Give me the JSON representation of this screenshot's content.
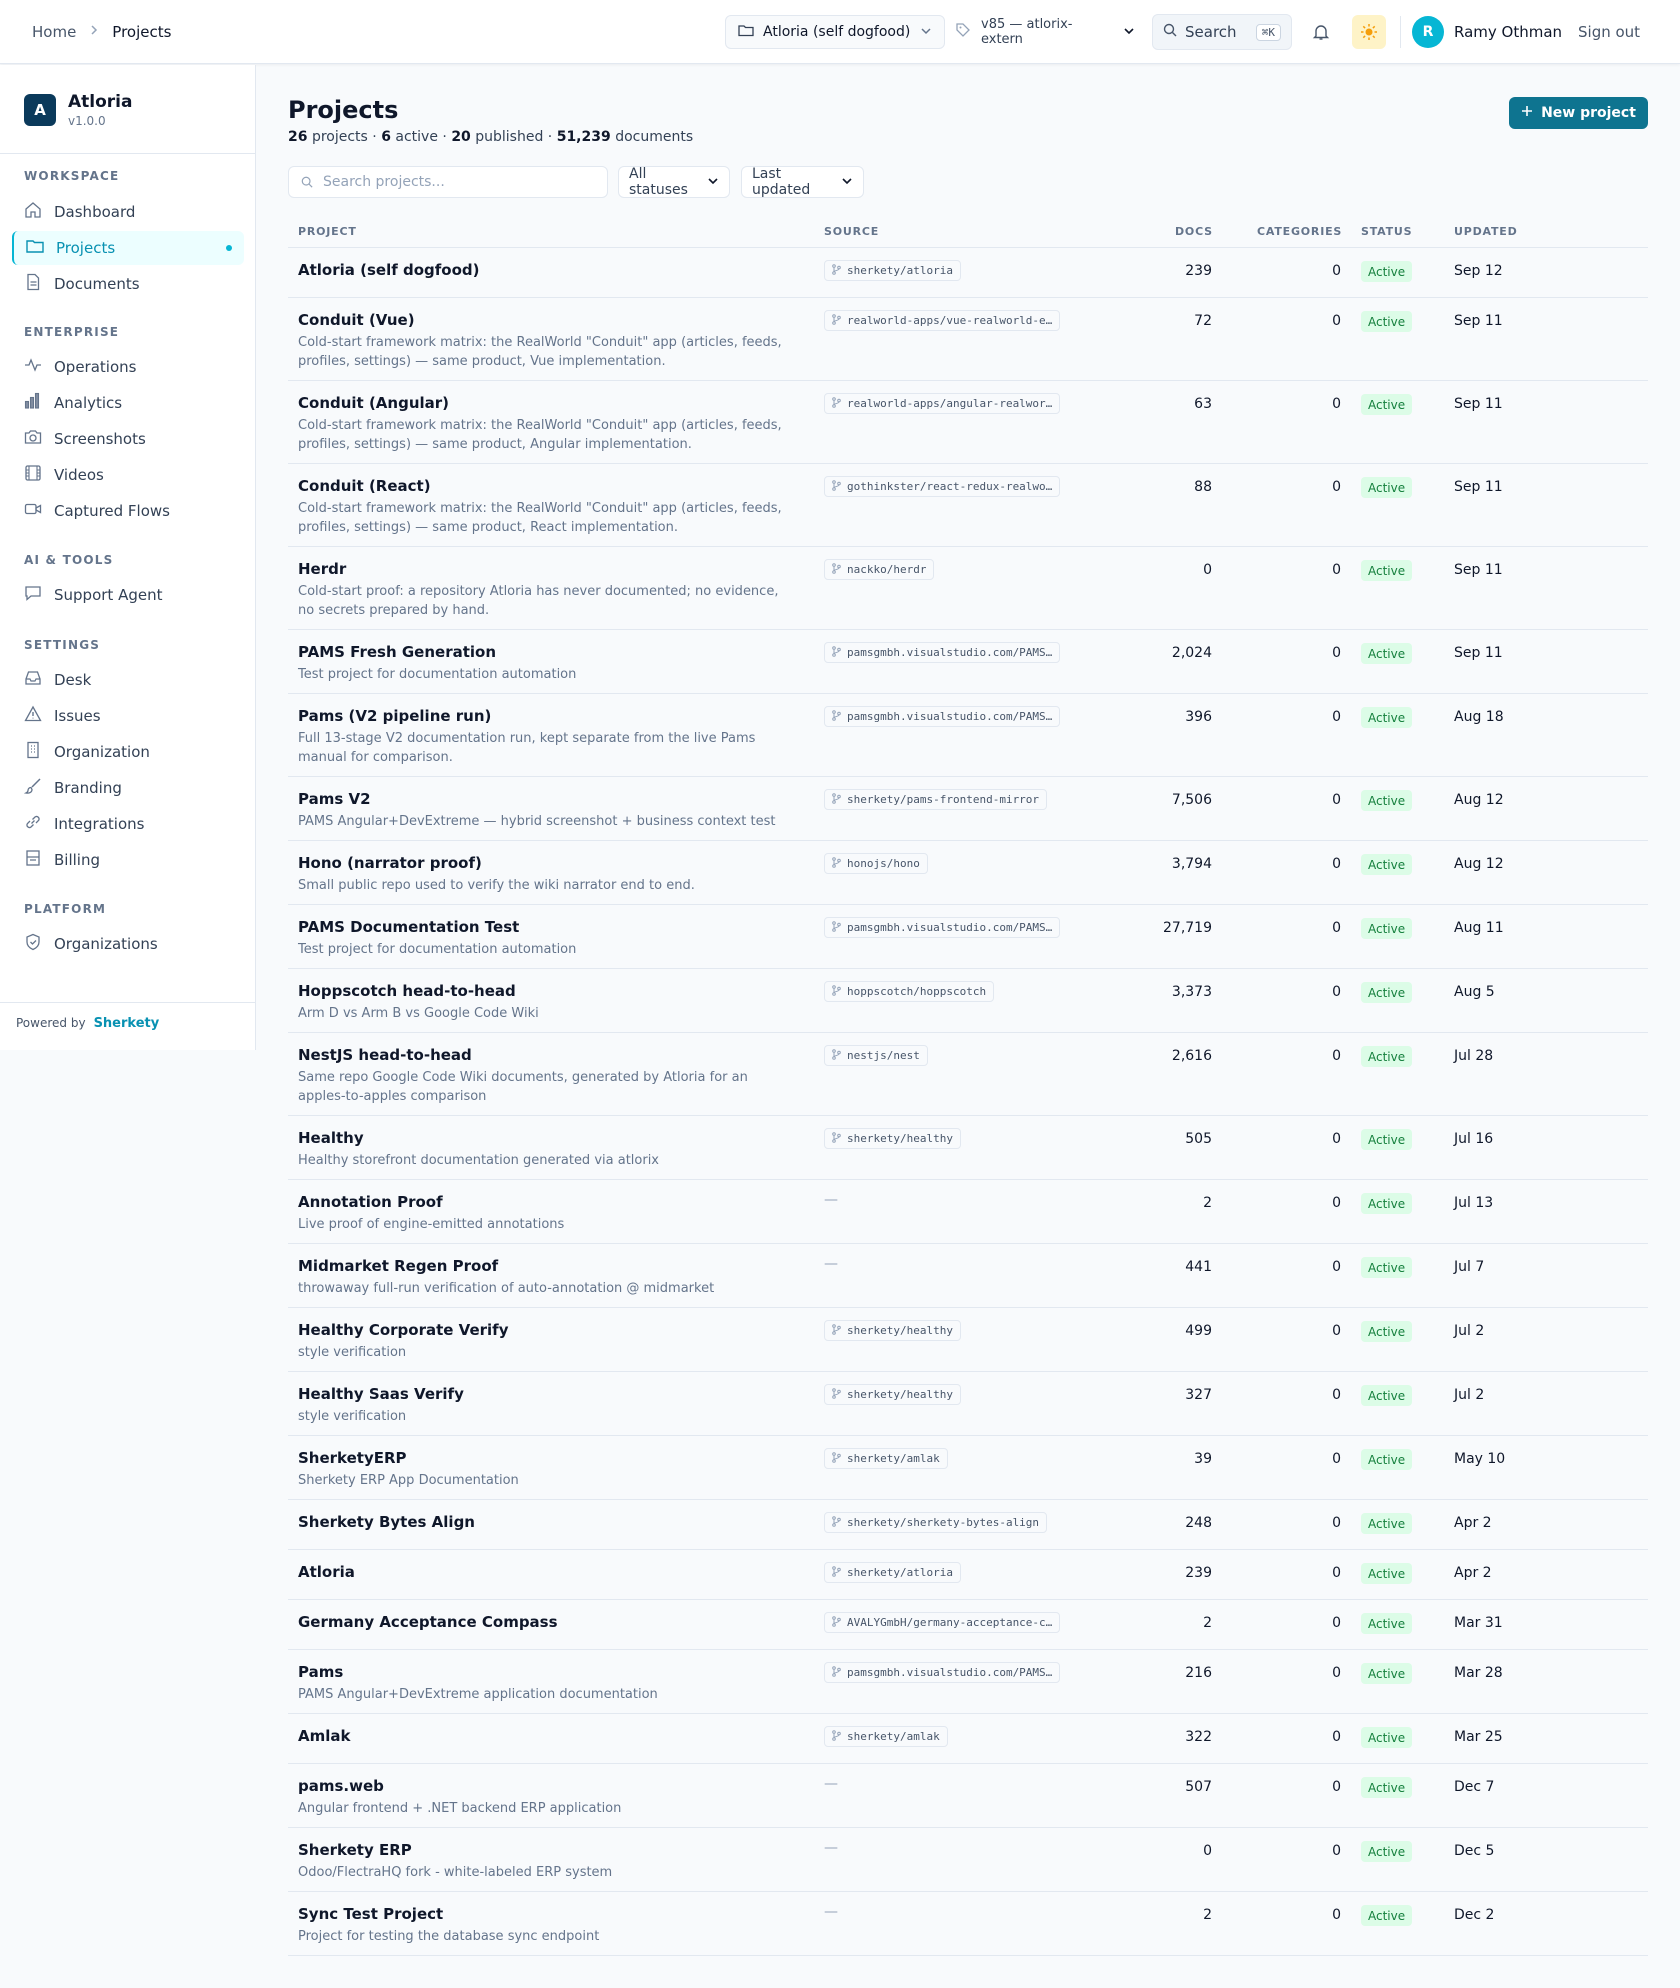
{
  "breadcrumb": {
    "home": "Home",
    "current": "Projects"
  },
  "topbar": {
    "project_switcher": "Atloria (self dogfood)",
    "version": "v85 — atlorix-extern",
    "search_label": "Search",
    "search_shortcut": "⌘K",
    "user_initial": "R",
    "user_name": "Ramy Othman",
    "sign_out": "Sign out"
  },
  "sidebar": {
    "app_name": "Atloria",
    "app_version": "v1.0.0",
    "sections": [
      {
        "title": "WORKSPACE",
        "items": [
          {
            "label": "Dashboard",
            "icon": "home-icon"
          },
          {
            "label": "Projects",
            "icon": "folder-icon",
            "active": true
          },
          {
            "label": "Documents",
            "icon": "document-icon"
          }
        ]
      },
      {
        "title": "ENTERPRISE",
        "items": [
          {
            "label": "Operations",
            "icon": "pulse-icon"
          },
          {
            "label": "Analytics",
            "icon": "bar-chart-icon"
          },
          {
            "label": "Screenshots",
            "icon": "camera-icon"
          },
          {
            "label": "Videos",
            "icon": "film-icon"
          },
          {
            "label": "Captured Flows",
            "icon": "video-camera-icon"
          }
        ]
      },
      {
        "title": "AI & TOOLS",
        "items": [
          {
            "label": "Support Agent",
            "icon": "chat-icon"
          }
        ]
      },
      {
        "title": "SETTINGS",
        "items": [
          {
            "label": "Desk",
            "icon": "inbox-icon"
          },
          {
            "label": "Issues",
            "icon": "warning-icon"
          },
          {
            "label": "Organization",
            "icon": "building-icon"
          },
          {
            "label": "Branding",
            "icon": "brush-icon"
          },
          {
            "label": "Integrations",
            "icon": "link-icon"
          },
          {
            "label": "Billing",
            "icon": "receipt-icon"
          }
        ]
      },
      {
        "title": "PLATFORM",
        "items": [
          {
            "label": "Organizations",
            "icon": "shield-icon"
          }
        ]
      }
    ],
    "powered_by": "Powered by",
    "powered_brand": "Sherkety"
  },
  "main": {
    "title": "Projects",
    "stats": {
      "projects": "26",
      "projects_label": "projects ·",
      "active": "6",
      "active_label": "active ·",
      "published": "20",
      "published_label": "published ·",
      "documents": "51,239",
      "documents_label": "documents"
    },
    "new_project": "New project",
    "search_placeholder": "Search projects...",
    "status_filter": "All statuses",
    "sort": "Last updated"
  },
  "table": {
    "columns": {
      "project": "PROJECT",
      "source": "SOURCE",
      "docs": "DOCS",
      "categories": "CATEGORIES",
      "status": "STATUS",
      "updated": "UPDATED"
    },
    "rows": [
      {
        "name": "Atloria (self dogfood)",
        "desc": "",
        "source": "sherkety/atloria",
        "docs": "239",
        "categories": "0",
        "status": "Active",
        "updated": "Sep 12"
      },
      {
        "name": "Conduit (Vue)",
        "desc": "Cold-start framework matrix: the RealWorld \"Conduit\" app (articles, feeds, profiles, settings) — same product, Vue implementation.",
        "source": "realworld-apps/vue-realworld-e…",
        "docs": "72",
        "categories": "0",
        "status": "Active",
        "updated": "Sep 11"
      },
      {
        "name": "Conduit (Angular)",
        "desc": "Cold-start framework matrix: the RealWorld \"Conduit\" app (articles, feeds, profiles, settings) — same product, Angular implementation.",
        "source": "realworld-apps/angular-realwor…",
        "docs": "63",
        "categories": "0",
        "status": "Active",
        "updated": "Sep 11"
      },
      {
        "name": "Conduit (React)",
        "desc": "Cold-start framework matrix: the RealWorld \"Conduit\" app (articles, feeds, profiles, settings) — same product, React implementation.",
        "source": "gothinkster/react-redux-realwo…",
        "docs": "88",
        "categories": "0",
        "status": "Active",
        "updated": "Sep 11"
      },
      {
        "name": "Herdr",
        "desc": "Cold-start proof: a repository Atloria has never documented; no evidence, no secrets prepared by hand.",
        "source": "nackko/herdr",
        "docs": "0",
        "categories": "0",
        "status": "Active",
        "updated": "Sep 11"
      },
      {
        "name": "PAMS Fresh Generation",
        "desc": "Test project for documentation automation",
        "source": "pamsgmbh.visualstudio.com/PAMS…",
        "docs": "2,024",
        "categories": "0",
        "status": "Active",
        "updated": "Sep 11"
      },
      {
        "name": "Pams (V2 pipeline run)",
        "desc": "Full 13-stage V2 documentation run, kept separate from the live Pams manual for comparison.",
        "source": "pamsgmbh.visualstudio.com/PAMS…",
        "docs": "396",
        "categories": "0",
        "status": "Active",
        "updated": "Aug 18"
      },
      {
        "name": "Pams V2",
        "desc": "PAMS Angular+DevExtreme — hybrid screenshot + business context test",
        "source": "sherkety/pams-frontend-mirror",
        "docs": "7,506",
        "categories": "0",
        "status": "Active",
        "updated": "Aug 12"
      },
      {
        "name": "Hono (narrator proof)",
        "desc": "Small public repo used to verify the wiki narrator end to end.",
        "source": "honojs/hono",
        "docs": "3,794",
        "categories": "0",
        "status": "Active",
        "updated": "Aug 12"
      },
      {
        "name": "PAMS Documentation Test",
        "desc": "Test project for documentation automation",
        "source": "pamsgmbh.visualstudio.com/PAMS…",
        "docs": "27,719",
        "categories": "0",
        "status": "Active",
        "updated": "Aug 11"
      },
      {
        "name": "Hoppscotch head-to-head",
        "desc": "Arm D vs Arm B vs Google Code Wiki",
        "source": "hoppscotch/hoppscotch",
        "docs": "3,373",
        "categories": "0",
        "status": "Active",
        "updated": "Aug 5"
      },
      {
        "name": "NestJS head-to-head",
        "desc": "Same repo Google Code Wiki documents, generated by Atloria for an apples-to-apples comparison",
        "source": "nestjs/nest",
        "docs": "2,616",
        "categories": "0",
        "status": "Active",
        "updated": "Jul 28"
      },
      {
        "name": "Healthy",
        "desc": "Healthy storefront documentation generated via atlorix",
        "source": "sherkety/healthy",
        "docs": "505",
        "categories": "0",
        "status": "Active",
        "updated": "Jul 16"
      },
      {
        "name": "Annotation Proof",
        "desc": "Live proof of engine-emitted annotations",
        "source": "",
        "docs": "2",
        "categories": "0",
        "status": "Active",
        "updated": "Jul 13"
      },
      {
        "name": "Midmarket Regen Proof",
        "desc": "throwaway full-run verification of auto-annotation @ midmarket",
        "source": "",
        "docs": "441",
        "categories": "0",
        "status": "Active",
        "updated": "Jul 7"
      },
      {
        "name": "Healthy Corporate Verify",
        "desc": "style verification",
        "source": "sherkety/healthy",
        "docs": "499",
        "categories": "0",
        "status": "Active",
        "updated": "Jul 2"
      },
      {
        "name": "Healthy Saas Verify",
        "desc": "style verification",
        "source": "sherkety/healthy",
        "docs": "327",
        "categories": "0",
        "status": "Active",
        "updated": "Jul 2"
      },
      {
        "name": "SherketyERP",
        "desc": "Sherkety ERP App Documentation",
        "source": "sherkety/amlak",
        "docs": "39",
        "categories": "0",
        "status": "Active",
        "updated": "May 10"
      },
      {
        "name": "Sherkety Bytes Align",
        "desc": "",
        "source": "sherkety/sherkety-bytes-align",
        "docs": "248",
        "categories": "0",
        "status": "Active",
        "updated": "Apr 2"
      },
      {
        "name": "Atloria",
        "desc": "",
        "source": "sherkety/atloria",
        "docs": "239",
        "categories": "0",
        "status": "Active",
        "updated": "Apr 2"
      },
      {
        "name": "Germany Acceptance Compass",
        "desc": "",
        "source": "AVALYGmbH/germany-acceptance-c…",
        "docs": "2",
        "categories": "0",
        "status": "Active",
        "updated": "Mar 31"
      },
      {
        "name": "Pams",
        "desc": "PAMS Angular+DevExtreme application documentation",
        "source": "pamsgmbh.visualstudio.com/PAMS…",
        "docs": "216",
        "categories": "0",
        "status": "Active",
        "updated": "Mar 28"
      },
      {
        "name": "Amlak",
        "desc": "",
        "source": "sherkety/amlak",
        "docs": "322",
        "categories": "0",
        "status": "Active",
        "updated": "Mar 25"
      },
      {
        "name": "pams.web",
        "desc": "Angular frontend + .NET backend ERP application",
        "source": "",
        "docs": "507",
        "categories": "0",
        "status": "Active",
        "updated": "Dec 7"
      },
      {
        "name": "Sherkety ERP",
        "desc": "Odoo/FlectraHQ fork - white-labeled ERP system",
        "source": "",
        "docs": "0",
        "categories": "0",
        "status": "Active",
        "updated": "Dec 5"
      },
      {
        "name": "Sync Test Project",
        "desc": "Project for testing the database sync endpoint",
        "source": "",
        "docs": "2",
        "categories": "0",
        "status": "Active",
        "updated": "Dec 2"
      }
    ]
  },
  "colors": {
    "accent": "#0e7490",
    "accent_light": "#06b6d4",
    "status_bg": "#dcfce7",
    "status_fg": "#15803d"
  }
}
